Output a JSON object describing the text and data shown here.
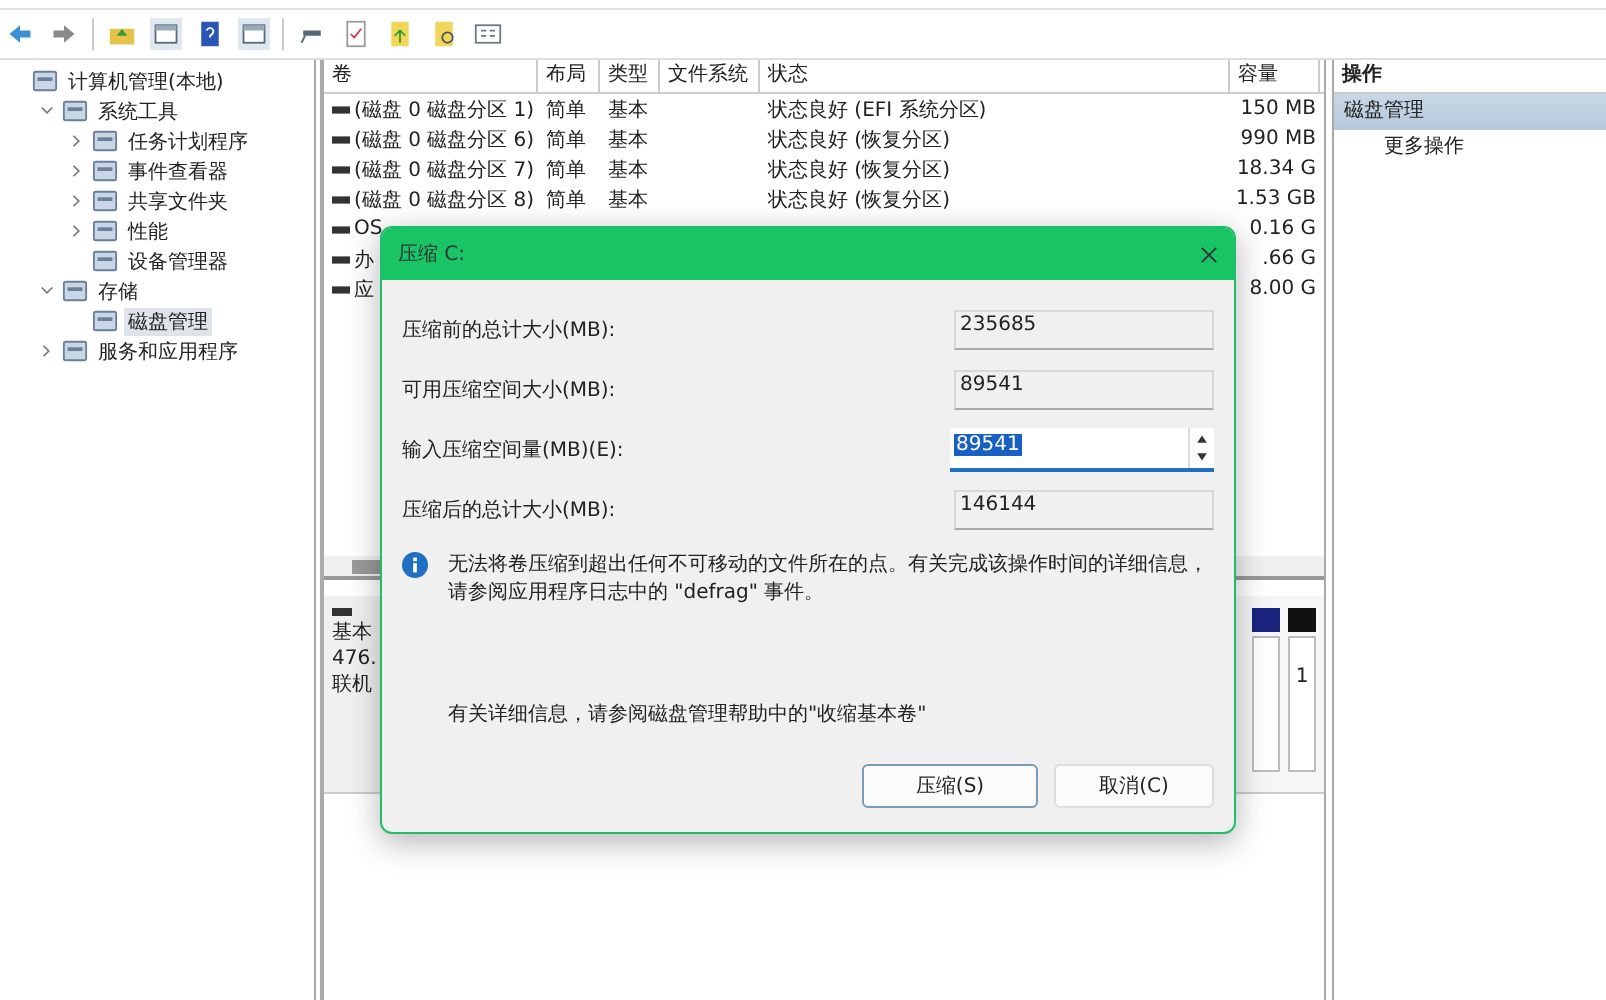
{
  "tree": [
    {
      "label": "计算机管理(本地)",
      "selected": false,
      "children": [
        {
          "label": "系统工具",
          "expanded": true,
          "selected": false,
          "children": [
            {
              "label": "任务计划程序",
              "expanded": false,
              "selected": false
            },
            {
              "label": "事件查看器",
              "expanded": false,
              "selected": false
            },
            {
              "label": "共享文件夹",
              "expanded": false,
              "selected": false
            },
            {
              "label": "性能",
              "expanded": false,
              "selected": false
            },
            {
              "label": "设备管理器",
              "selected": false
            }
          ]
        },
        {
          "label": "存储",
          "expanded": true,
          "selected": false,
          "children": [
            {
              "label": "磁盘管理",
              "selected": true
            }
          ]
        },
        {
          "label": "服务和应用程序",
          "expanded": false,
          "selected": false
        }
      ]
    }
  ],
  "table": {
    "columns": [
      "卷",
      "布局",
      "类型",
      "文件系统",
      "状态",
      "容量"
    ],
    "rows": [
      [
        "(磁盘 0 磁盘分区 1)",
        "简单",
        "基本",
        "",
        "状态良好 (EFI 系统分区)",
        "150 MB"
      ],
      [
        "(磁盘 0 磁盘分区 6)",
        "简单",
        "基本",
        "",
        "状态良好 (恢复分区)",
        "990 MB"
      ],
      [
        "(磁盘 0 磁盘分区 7)",
        "简单",
        "基本",
        "",
        "状态良好 (恢复分区)",
        "18.34 G"
      ],
      [
        "(磁盘 0 磁盘分区 8)",
        "简单",
        "基本",
        "",
        "状态良好 (恢复分区)",
        "1.53 GB"
      ],
      [
        "OS",
        "",
        "",
        "",
        "",
        "0.16 G"
      ],
      [
        "办",
        "",
        "",
        "",
        "",
        ".66 G"
      ],
      [
        "应",
        "",
        "",
        "",
        "",
        "8.00 G"
      ]
    ]
  },
  "disk": {
    "lines": [
      "基本",
      "476.",
      "联机"
    ],
    "partition_label": "1"
  },
  "actions": {
    "title": "操作",
    "items": [
      {
        "label": "磁盘管理",
        "selected": true
      },
      {
        "label": "更多操作",
        "selected": false
      }
    ]
  },
  "dialog": {
    "title": "压缩 C:",
    "fields": [
      {
        "label": "压缩前的总计大小(MB):",
        "value": "235685",
        "kind": "readonly"
      },
      {
        "label": "可用压缩空间大小(MB):",
        "value": "89541",
        "kind": "readonly"
      },
      {
        "label": "输入压缩空间量(MB)(E):",
        "value": "89541",
        "kind": "spin"
      },
      {
        "label": "压缩后的总计大小(MB):",
        "value": "146144",
        "kind": "readonly"
      }
    ],
    "info": "无法将卷压缩到超出任何不可移动的文件所在的点。有关完成该操作时间的详细信息，请参阅应用程序日志中的 \"defrag\" 事件。",
    "help": "有关详细信息，请参阅磁盘管理帮助中的\"收缩基本卷\"",
    "buttons": [
      {
        "label": "压缩(S)",
        "selected": true
      },
      {
        "label": "取消(C)",
        "selected": false
      }
    ]
  }
}
